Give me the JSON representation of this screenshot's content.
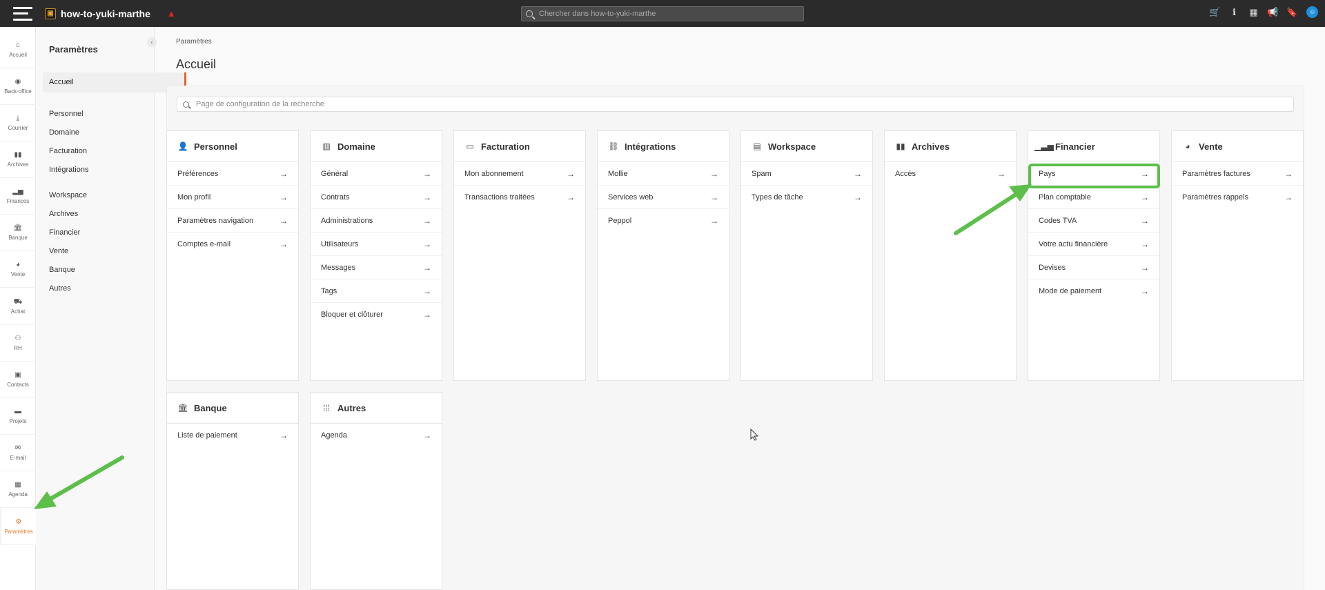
{
  "topbar": {
    "brand": "how-to-yuki-marthe",
    "search_placeholder": "Chercher dans how-to-yuki-marthe",
    "icons": [
      "cart-icon",
      "info-icon",
      "store-icon",
      "megaphone-icon",
      "bookmark-icon",
      "user-avatar-icon"
    ]
  },
  "rail": [
    {
      "label": "Accueil",
      "icon": "home-icon"
    },
    {
      "label": "Back-office",
      "icon": "backoffice-icon"
    },
    {
      "label": "Courrier",
      "icon": "inbox-icon"
    },
    {
      "label": "Archives",
      "icon": "archives-icon"
    },
    {
      "label": "Finances",
      "icon": "chart-icon"
    },
    {
      "label": "Banque",
      "icon": "bank-icon"
    },
    {
      "label": "Vente",
      "icon": "handshake-icon"
    },
    {
      "label": "Achat",
      "icon": "truck-icon"
    },
    {
      "label": "RH",
      "icon": "people-icon"
    },
    {
      "label": "Contacts",
      "icon": "contact-icon"
    },
    {
      "label": "Projets",
      "icon": "folder-icon"
    },
    {
      "label": "E-mail",
      "icon": "mail-icon"
    },
    {
      "label": "Agenda",
      "icon": "calendar-icon"
    },
    {
      "label": "Paramètres",
      "icon": "settings-icon"
    }
  ],
  "subnav": {
    "title": "Paramètres",
    "active": "Accueil",
    "group1": [
      "Personnel",
      "Domaine",
      "Facturation",
      "Intégrations"
    ],
    "group2": [
      "Workspace",
      "Archives",
      "Financier",
      "Vente",
      "Banque",
      "Autres"
    ]
  },
  "main": {
    "breadcrumb": "Paramètres",
    "title": "Accueil",
    "search_placeholder": "Page de configuration de la recherche"
  },
  "cards": [
    {
      "title": "Personnel",
      "icon": "person-icon",
      "items": [
        "Préférences",
        "Mon profil",
        "Paramètres navigation",
        "Comptes e-mail"
      ]
    },
    {
      "title": "Domaine",
      "icon": "building-icon",
      "items": [
        "Général",
        "Contrats",
        "Administrations",
        "Utilisateurs",
        "Messages",
        "Tags",
        "Bloquer et clôturer"
      ]
    },
    {
      "title": "Facturation",
      "icon": "billing-icon",
      "items": [
        "Mon abonnement",
        "Transactions traitées"
      ]
    },
    {
      "title": "Intégrations",
      "icon": "link-icon",
      "items": [
        "Mollie",
        "Services web",
        "Peppol"
      ]
    },
    {
      "title": "Workspace",
      "icon": "workspace-icon",
      "items": [
        "Spam",
        "Types de tâche"
      ]
    },
    {
      "title": "Archives",
      "icon": "archive-books-icon",
      "items": [
        "Accès"
      ]
    },
    {
      "title": "Financier",
      "icon": "bar-chart-icon",
      "items": [
        "Pays",
        "Plan comptable",
        "Codes TVA",
        "Votre actu financière",
        "Devises",
        "Mode de paiement"
      ]
    },
    {
      "title": "Vente",
      "icon": "handshake-icon",
      "items": [
        "Paramètres factures",
        "Paramètres rappels"
      ]
    },
    {
      "title": "Banque",
      "icon": "bank-icon",
      "items": [
        "Liste de paiement"
      ]
    },
    {
      "title": "Autres",
      "icon": "grid-icon",
      "items": [
        "Agenda"
      ]
    }
  ],
  "colors": {
    "topbar_bg": "#2b2b2b",
    "accent_orange": "#e87722",
    "annotation_green": "#5cbf4a"
  }
}
